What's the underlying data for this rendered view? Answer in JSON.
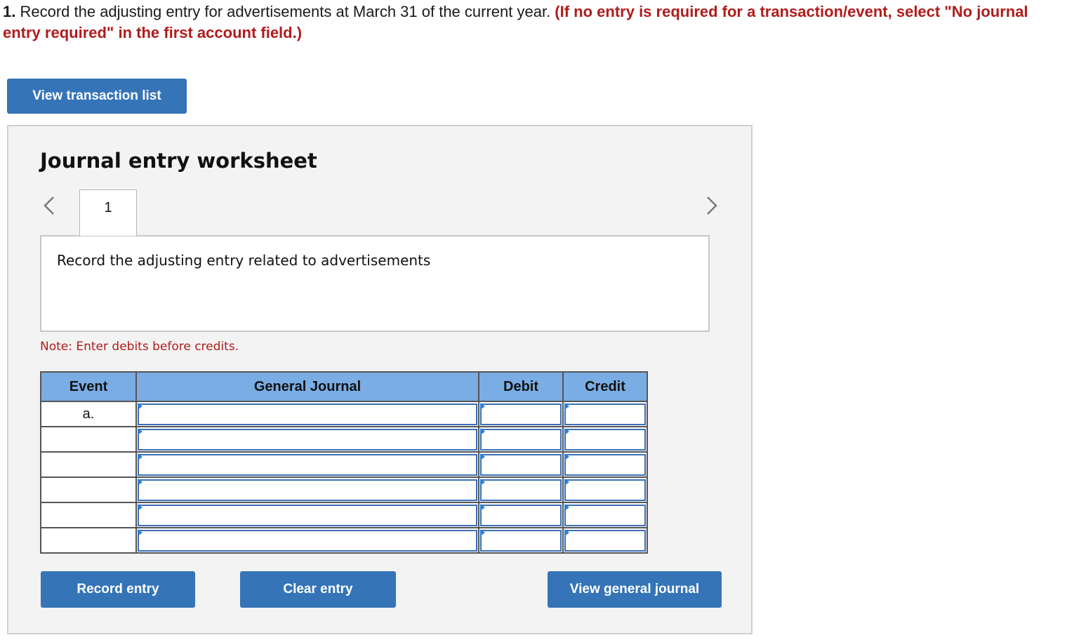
{
  "question": {
    "number": "1.",
    "text": " Record the adjusting entry for advertisements at March 31 of the current year. ",
    "instruction": "(If no entry is required for a transaction/event, select \"No journal entry required\" in the first account field.)"
  },
  "buttons": {
    "view_transaction_list": "View transaction list",
    "record_entry": "Record entry",
    "clear_entry": "Clear entry",
    "view_general_journal": "View general journal"
  },
  "worksheet": {
    "title": "Journal entry worksheet",
    "tabs": [
      {
        "label": "1"
      }
    ],
    "prompt": "Record the adjusting entry related to advertisements",
    "note": "Note: Enter debits before credits."
  },
  "table": {
    "headers": {
      "event": "Event",
      "general_journal": "General Journal",
      "debit": "Debit",
      "credit": "Credit"
    },
    "rows": [
      {
        "event": "a.",
        "account": "",
        "debit": "",
        "credit": ""
      },
      {
        "event": "",
        "account": "",
        "debit": "",
        "credit": ""
      },
      {
        "event": "",
        "account": "",
        "debit": "",
        "credit": ""
      },
      {
        "event": "",
        "account": "",
        "debit": "",
        "credit": ""
      },
      {
        "event": "",
        "account": "",
        "debit": "",
        "credit": ""
      },
      {
        "event": "",
        "account": "",
        "debit": "",
        "credit": ""
      }
    ]
  },
  "colors": {
    "accent_button": "#3574b6",
    "header_blue": "#7aade4",
    "instruction_red": "#b01c1c",
    "panel_gray": "#f3f3f3"
  },
  "icons": {
    "prev": "chevron-left-icon",
    "next": "chevron-right-icon"
  }
}
